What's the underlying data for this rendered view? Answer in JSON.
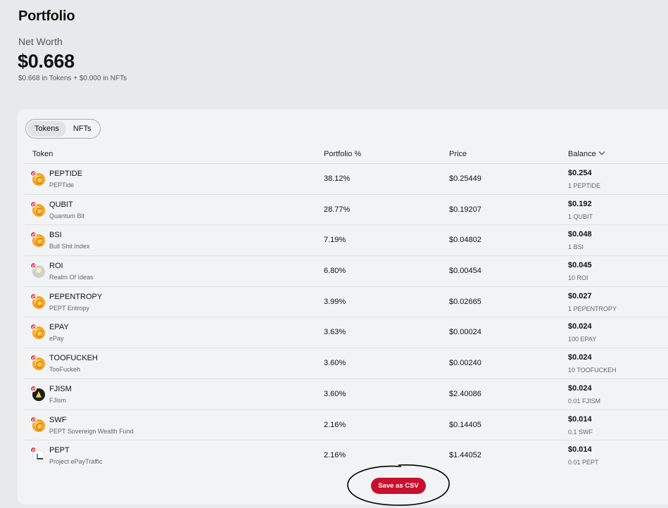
{
  "page": {
    "title": "Portfolio"
  },
  "networth": {
    "label": "Net Worth",
    "value": "$0.668",
    "breakdown": "$0.668 in Tokens + $0.000 in NFTs"
  },
  "tabs": [
    {
      "label": "Tokens",
      "active": true
    },
    {
      "label": "NFTs",
      "active": false
    }
  ],
  "table": {
    "headers": {
      "token": "Token",
      "pct": "Portfolio %",
      "price": "Price",
      "balance": "Balance"
    },
    "rows": [
      {
        "symbol": "PEPTIDE",
        "name": "PEPTide",
        "pct": "38.12%",
        "price": "$0.25449",
        "balance": "$0.254",
        "amount": "1 PEPTIDE",
        "logo": "orange"
      },
      {
        "symbol": "QUBIT",
        "name": "Quantum Bit",
        "pct": "28.77%",
        "price": "$0.19207",
        "balance": "$0.192",
        "amount": "1 QUBIT",
        "logo": "orange"
      },
      {
        "symbol": "BSI",
        "name": "Bull Shit Index",
        "pct": "7.19%",
        "price": "$0.04802",
        "balance": "$0.048",
        "amount": "1 BSI",
        "logo": "orange"
      },
      {
        "symbol": "ROI",
        "name": "Realm Of Ideas",
        "pct": "6.80%",
        "price": "$0.00454",
        "balance": "$0.045",
        "amount": "10 ROI",
        "logo": "gray"
      },
      {
        "symbol": "PEPENTROPY",
        "name": "PEPT Entropy",
        "pct": "3.99%",
        "price": "$0.02665",
        "balance": "$0.027",
        "amount": "1 PEPENTROPY",
        "logo": "orange"
      },
      {
        "symbol": "EPAY",
        "name": "ePay",
        "pct": "3.63%",
        "price": "$0.00024",
        "balance": "$0.024",
        "amount": "100 EPAY",
        "logo": "orange"
      },
      {
        "symbol": "TOOFUCKEH",
        "name": "TooFuckeh",
        "pct": "3.60%",
        "price": "$0.00240",
        "balance": "$0.024",
        "amount": "10 TOOFUCKEH",
        "logo": "orange"
      },
      {
        "symbol": "FJISM",
        "name": "FJism",
        "pct": "3.60%",
        "price": "$2.40086",
        "balance": "$0.024",
        "amount": "0.01 FJISM",
        "logo": "dark"
      },
      {
        "symbol": "SWF",
        "name": "PEPT Sovereign Wealth Fund",
        "pct": "2.16%",
        "price": "$0.14405",
        "balance": "$0.014",
        "amount": "0.1 SWF",
        "logo": "orange"
      },
      {
        "symbol": "PEPT",
        "name": "Project ePayTraffic",
        "pct": "2.16%",
        "price": "$1.44052",
        "balance": "$0.014",
        "amount": "0.01 PEPT",
        "logo": "white"
      }
    ]
  },
  "actions": {
    "save_csv": "Save as CSV"
  },
  "colors": {
    "accent": "#c8102e",
    "badge": "#e0424c"
  }
}
